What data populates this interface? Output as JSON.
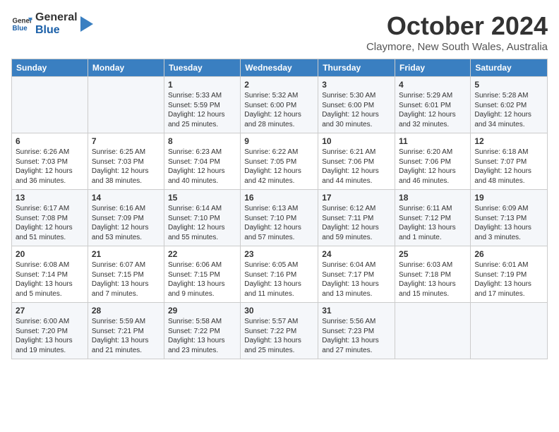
{
  "logo": {
    "line1": "General",
    "line2": "Blue"
  },
  "title": "October 2024",
  "location": "Claymore, New South Wales, Australia",
  "days_of_week": [
    "Sunday",
    "Monday",
    "Tuesday",
    "Wednesday",
    "Thursday",
    "Friday",
    "Saturday"
  ],
  "weeks": [
    [
      {
        "day": "",
        "content": ""
      },
      {
        "day": "",
        "content": ""
      },
      {
        "day": "1",
        "content": "Sunrise: 5:33 AM\nSunset: 5:59 PM\nDaylight: 12 hours\nand 25 minutes."
      },
      {
        "day": "2",
        "content": "Sunrise: 5:32 AM\nSunset: 6:00 PM\nDaylight: 12 hours\nand 28 minutes."
      },
      {
        "day": "3",
        "content": "Sunrise: 5:30 AM\nSunset: 6:00 PM\nDaylight: 12 hours\nand 30 minutes."
      },
      {
        "day": "4",
        "content": "Sunrise: 5:29 AM\nSunset: 6:01 PM\nDaylight: 12 hours\nand 32 minutes."
      },
      {
        "day": "5",
        "content": "Sunrise: 5:28 AM\nSunset: 6:02 PM\nDaylight: 12 hours\nand 34 minutes."
      }
    ],
    [
      {
        "day": "6",
        "content": "Sunrise: 6:26 AM\nSunset: 7:03 PM\nDaylight: 12 hours\nand 36 minutes."
      },
      {
        "day": "7",
        "content": "Sunrise: 6:25 AM\nSunset: 7:03 PM\nDaylight: 12 hours\nand 38 minutes."
      },
      {
        "day": "8",
        "content": "Sunrise: 6:23 AM\nSunset: 7:04 PM\nDaylight: 12 hours\nand 40 minutes."
      },
      {
        "day": "9",
        "content": "Sunrise: 6:22 AM\nSunset: 7:05 PM\nDaylight: 12 hours\nand 42 minutes."
      },
      {
        "day": "10",
        "content": "Sunrise: 6:21 AM\nSunset: 7:06 PM\nDaylight: 12 hours\nand 44 minutes."
      },
      {
        "day": "11",
        "content": "Sunrise: 6:20 AM\nSunset: 7:06 PM\nDaylight: 12 hours\nand 46 minutes."
      },
      {
        "day": "12",
        "content": "Sunrise: 6:18 AM\nSunset: 7:07 PM\nDaylight: 12 hours\nand 48 minutes."
      }
    ],
    [
      {
        "day": "13",
        "content": "Sunrise: 6:17 AM\nSunset: 7:08 PM\nDaylight: 12 hours\nand 51 minutes."
      },
      {
        "day": "14",
        "content": "Sunrise: 6:16 AM\nSunset: 7:09 PM\nDaylight: 12 hours\nand 53 minutes."
      },
      {
        "day": "15",
        "content": "Sunrise: 6:14 AM\nSunset: 7:10 PM\nDaylight: 12 hours\nand 55 minutes."
      },
      {
        "day": "16",
        "content": "Sunrise: 6:13 AM\nSunset: 7:10 PM\nDaylight: 12 hours\nand 57 minutes."
      },
      {
        "day": "17",
        "content": "Sunrise: 6:12 AM\nSunset: 7:11 PM\nDaylight: 12 hours\nand 59 minutes."
      },
      {
        "day": "18",
        "content": "Sunrise: 6:11 AM\nSunset: 7:12 PM\nDaylight: 13 hours\nand 1 minute."
      },
      {
        "day": "19",
        "content": "Sunrise: 6:09 AM\nSunset: 7:13 PM\nDaylight: 13 hours\nand 3 minutes."
      }
    ],
    [
      {
        "day": "20",
        "content": "Sunrise: 6:08 AM\nSunset: 7:14 PM\nDaylight: 13 hours\nand 5 minutes."
      },
      {
        "day": "21",
        "content": "Sunrise: 6:07 AM\nSunset: 7:15 PM\nDaylight: 13 hours\nand 7 minutes."
      },
      {
        "day": "22",
        "content": "Sunrise: 6:06 AM\nSunset: 7:15 PM\nDaylight: 13 hours\nand 9 minutes."
      },
      {
        "day": "23",
        "content": "Sunrise: 6:05 AM\nSunset: 7:16 PM\nDaylight: 13 hours\nand 11 minutes."
      },
      {
        "day": "24",
        "content": "Sunrise: 6:04 AM\nSunset: 7:17 PM\nDaylight: 13 hours\nand 13 minutes."
      },
      {
        "day": "25",
        "content": "Sunrise: 6:03 AM\nSunset: 7:18 PM\nDaylight: 13 hours\nand 15 minutes."
      },
      {
        "day": "26",
        "content": "Sunrise: 6:01 AM\nSunset: 7:19 PM\nDaylight: 13 hours\nand 17 minutes."
      }
    ],
    [
      {
        "day": "27",
        "content": "Sunrise: 6:00 AM\nSunset: 7:20 PM\nDaylight: 13 hours\nand 19 minutes."
      },
      {
        "day": "28",
        "content": "Sunrise: 5:59 AM\nSunset: 7:21 PM\nDaylight: 13 hours\nand 21 minutes."
      },
      {
        "day": "29",
        "content": "Sunrise: 5:58 AM\nSunset: 7:22 PM\nDaylight: 13 hours\nand 23 minutes."
      },
      {
        "day": "30",
        "content": "Sunrise: 5:57 AM\nSunset: 7:22 PM\nDaylight: 13 hours\nand 25 minutes."
      },
      {
        "day": "31",
        "content": "Sunrise: 5:56 AM\nSunset: 7:23 PM\nDaylight: 13 hours\nand 27 minutes."
      },
      {
        "day": "",
        "content": ""
      },
      {
        "day": "",
        "content": ""
      }
    ]
  ]
}
